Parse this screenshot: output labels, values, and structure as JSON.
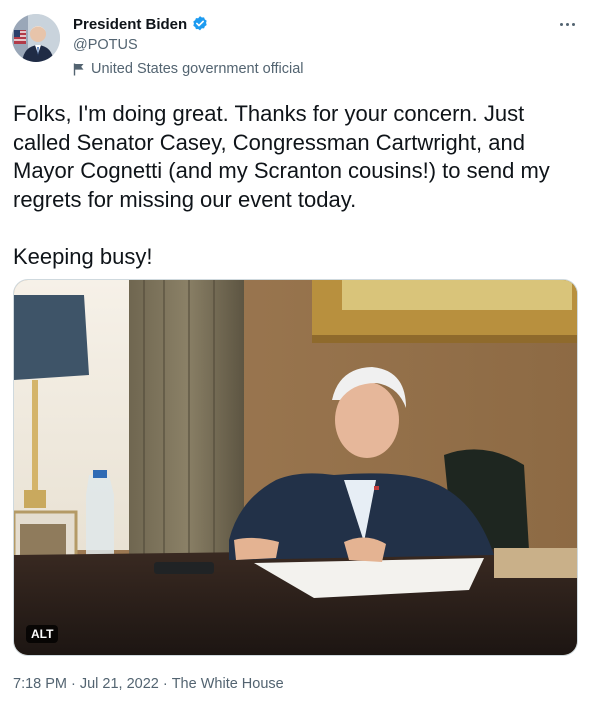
{
  "author": {
    "name": "President Biden",
    "handle": "@POTUS",
    "label": "United States government official"
  },
  "tweet": {
    "text": "Folks, I'm doing great. Thanks for your concern. Just called Senator Casey, Congressman Cartwright, and Mayor Cognetti (and my Scranton cousins!) to send my regrets for missing our event today.\n\nKeeping busy!",
    "alt_badge": "ALT",
    "time": "7:18 PM",
    "date": "Jul 21, 2022",
    "source": "The White House",
    "separator": "·"
  },
  "colors": {
    "verified_blue": "#1d9bf0",
    "secondary_text": "#536471",
    "primary_text": "#0f1419"
  },
  "icons": [
    "verified-badge-icon",
    "government-flag-icon",
    "more-options-icon"
  ]
}
